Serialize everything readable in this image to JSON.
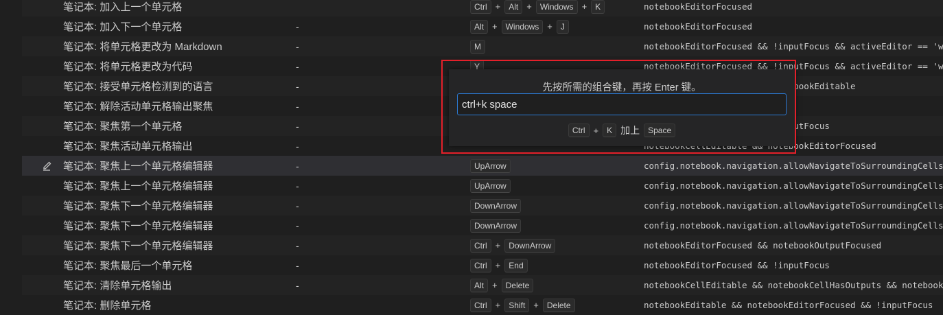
{
  "rows": [
    {
      "command": "笔记本: 加入上一个单元格",
      "source": "",
      "keys": [
        "Ctrl",
        "Alt",
        "Windows",
        "K"
      ],
      "when": "notebookEditorFocused"
    },
    {
      "command": "笔记本: 加入下一个单元格",
      "source": "-",
      "keys": [
        "Alt",
        "Windows",
        "J"
      ],
      "when": "notebookEditorFocused"
    },
    {
      "command": "笔记本: 将单元格更改为 Markdown",
      "source": "-",
      "keys": [
        "M"
      ],
      "when": "notebookEditorFocused && !inputFocus && activeEditor == 'w"
    },
    {
      "command": "笔记本: 将单元格更改为代码",
      "source": "-",
      "keys": [
        "Y"
      ],
      "when": "notebookEditorFocused && !inputFocus && activeEditor == 'w"
    },
    {
      "command": "笔记本: 接受单元格检测到的语言",
      "source": "-",
      "keys": [],
      "when": "notebookEditorFocused && notebookEditable"
    },
    {
      "command": "笔记本: 解除活动单元格输出聚焦",
      "source": "-",
      "keys": [],
      "when": ""
    },
    {
      "command": "笔记本: 聚焦第一个单元格",
      "source": "-",
      "keys": [],
      "when": "notebookEditorFocused && !inputFocus"
    },
    {
      "command": "笔记本: 聚焦活动单元格输出",
      "source": "-",
      "keys": [],
      "when": "notebookCellEditable && notebookEditorFocused"
    },
    {
      "command": "笔记本: 聚焦上一个单元格编辑器",
      "source": "-",
      "keys": [
        "UpArrow"
      ],
      "when": "config.notebook.navigation.allowNavigateToSurroundingCells"
    },
    {
      "command": "笔记本: 聚焦上一个单元格编辑器",
      "source": "-",
      "keys": [
        "UpArrow"
      ],
      "when": "config.notebook.navigation.allowNavigateToSurroundingCells"
    },
    {
      "command": "笔记本: 聚焦下一个单元格编辑器",
      "source": "-",
      "keys": [
        "DownArrow"
      ],
      "when": "config.notebook.navigation.allowNavigateToSurroundingCells"
    },
    {
      "command": "笔记本: 聚焦下一个单元格编辑器",
      "source": "-",
      "keys": [
        "DownArrow"
      ],
      "when": "config.notebook.navigation.allowNavigateToSurroundingCells"
    },
    {
      "command": "笔记本: 聚焦下一个单元格编辑器",
      "source": "-",
      "keys": [
        "Ctrl",
        "DownArrow"
      ],
      "when": "notebookEditorFocused && notebookOutputFocused"
    },
    {
      "command": "笔记本: 聚焦最后一个单元格",
      "source": "-",
      "keys": [
        "Ctrl",
        "End"
      ],
      "when": "notebookEditorFocused && !inputFocus"
    },
    {
      "command": "笔记本: 清除单元格输出",
      "source": "-",
      "keys": [
        "Alt",
        "Delete"
      ],
      "when": "notebookCellEditable && notebookCellHasOutputs && notebook"
    },
    {
      "command": "笔记本: 删除单元格",
      "source": "",
      "keys": [
        "Ctrl",
        "Shift",
        "Delete"
      ],
      "when": "notebookEditable && notebookEditorFocused && !inputFocus"
    }
  ],
  "selected_row_index": 8,
  "define_keybinding": {
    "message": "先按所需的组合键，再按 Enter 键。",
    "input_value": "ctrl+k space",
    "preview_first": [
      "Ctrl",
      "K"
    ],
    "preview_join": "加上",
    "preview_second": [
      "Space"
    ]
  },
  "colors": {
    "highlight_border": "#e5202a",
    "input_focus_border": "#2c7bd6"
  },
  "icons": {
    "edit": "pencil-edit-icon"
  }
}
